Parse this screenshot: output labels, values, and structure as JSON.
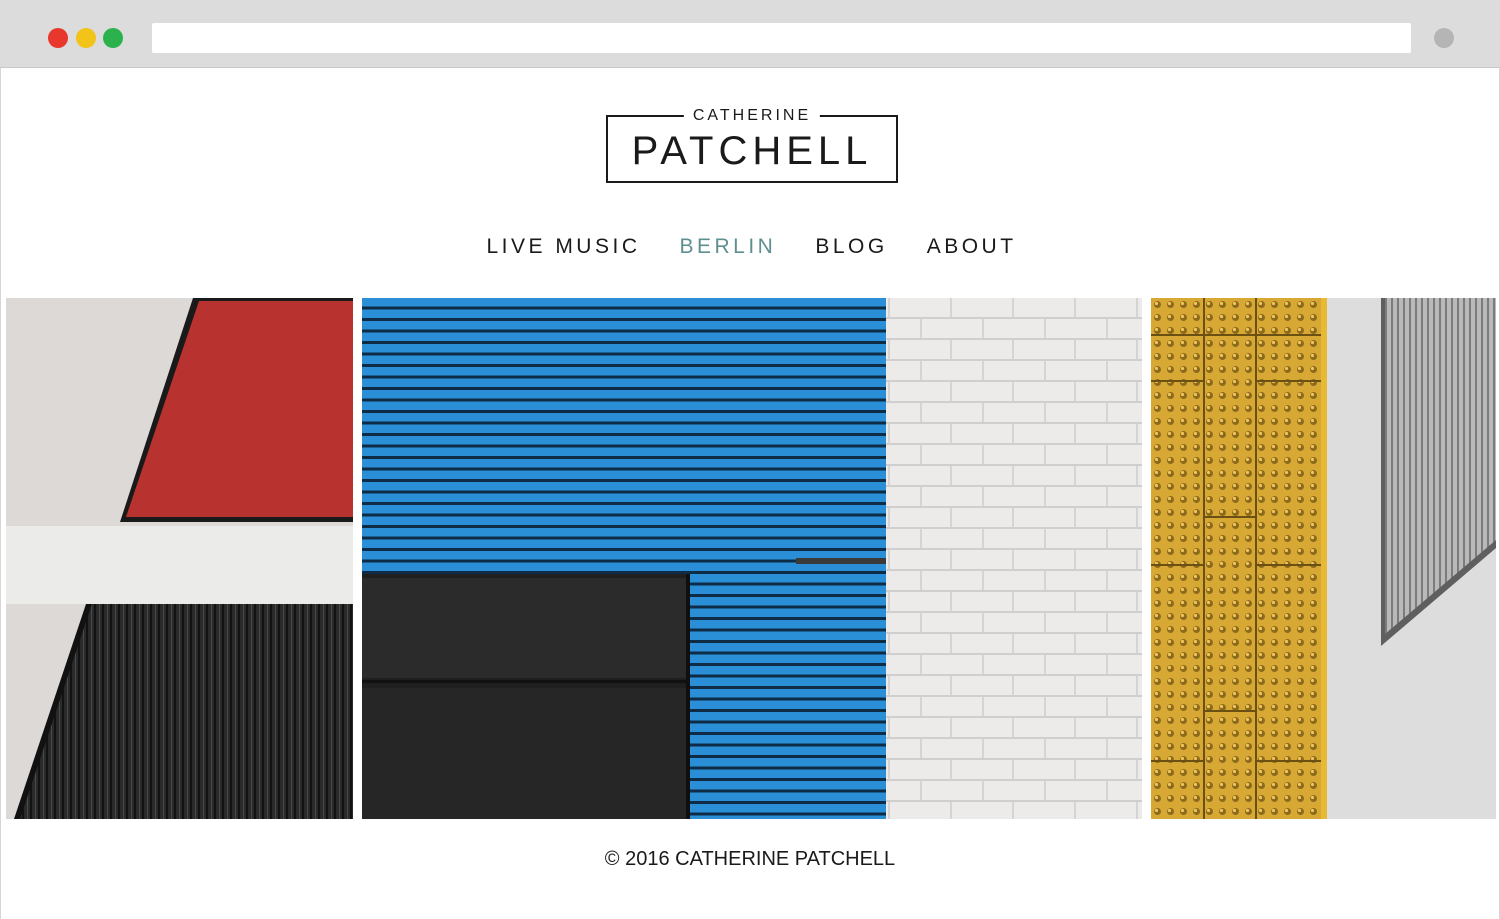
{
  "logo": {
    "first_name": "CATHERINE",
    "last_name": "PATCHELL"
  },
  "nav": {
    "items": [
      {
        "label": "LIVE MUSIC"
      },
      {
        "label": "BERLIN",
        "active": true
      },
      {
        "label": "BLOG"
      },
      {
        "label": "ABOUT"
      }
    ]
  },
  "footer": {
    "copyright": "© 2016 CATHERINE PATCHELL"
  },
  "colors": {
    "active_nav": "#5f8f8f",
    "text": "#1a1a1a",
    "chrome": "#dcdcdc",
    "close_dot": "#e8382e",
    "minimize_dot": "#f2c318",
    "maximize_dot": "#2bb24c"
  }
}
